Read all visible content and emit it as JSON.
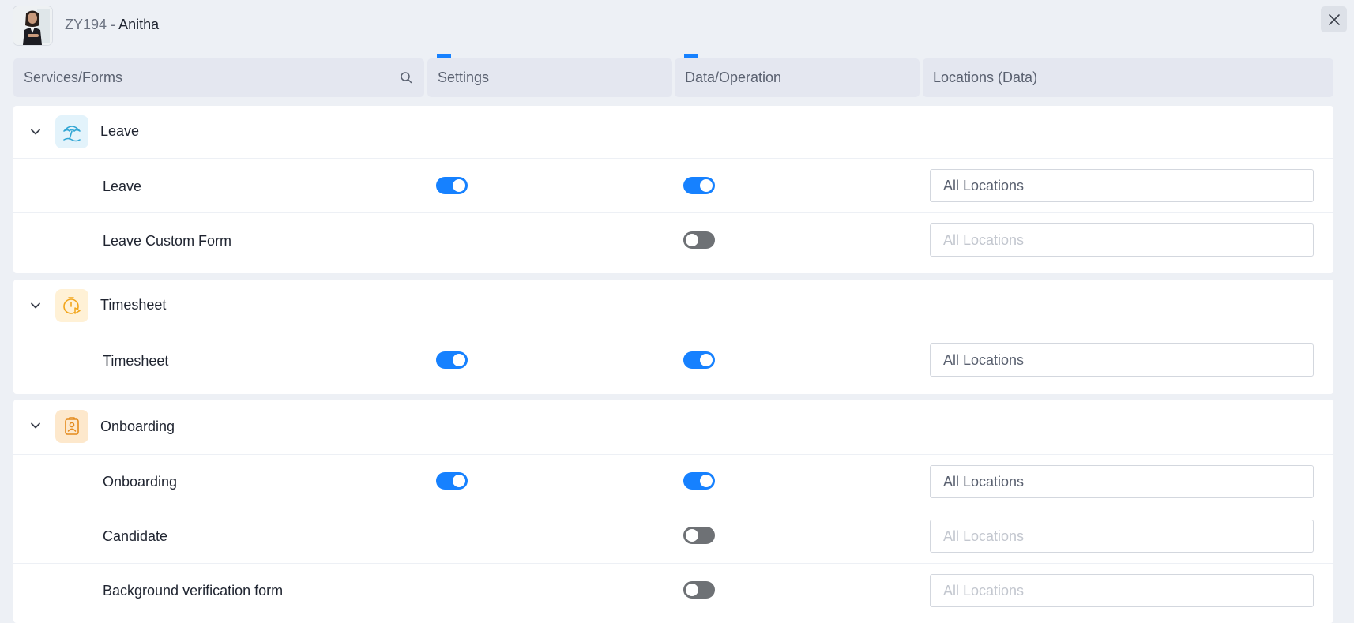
{
  "profile": {
    "id": "ZY194",
    "separator": " - ",
    "name": "Anitha"
  },
  "header": {
    "services": "Services/Forms",
    "settings": "Settings",
    "data_operation": "Data/Operation",
    "locations": "Locations (Data)"
  },
  "modules": [
    {
      "title": "Leave",
      "icon": "beach-umbrella-icon",
      "items": [
        {
          "name": "Leave",
          "settings": true,
          "data": true,
          "locations": "All Locations",
          "locations_enabled": true
        },
        {
          "name": "Leave Custom Form",
          "settings": null,
          "data": false,
          "locations": "All Locations",
          "locations_enabled": false
        }
      ]
    },
    {
      "title": "Timesheet",
      "icon": "stopwatch-icon",
      "items": [
        {
          "name": "Timesheet",
          "settings": true,
          "data": true,
          "locations": "All Locations",
          "locations_enabled": true
        }
      ]
    },
    {
      "title": "Onboarding",
      "icon": "id-badge-icon",
      "items": [
        {
          "name": "Onboarding",
          "settings": true,
          "data": true,
          "locations": "All Locations",
          "locations_enabled": true
        },
        {
          "name": "Candidate",
          "settings": null,
          "data": false,
          "locations": "All Locations",
          "locations_enabled": false
        },
        {
          "name": "Background verification form",
          "settings": null,
          "data": false,
          "locations": "All Locations",
          "locations_enabled": false
        }
      ]
    }
  ],
  "colors": {
    "accent": "#1681ff",
    "toggle_off": "#6e7175",
    "page_bg": "#edf0f5",
    "leave_icon_bg": "#e3f3fb",
    "timesheet_icon_bg": "#fff1d6",
    "onboarding_icon_bg": "#fde8cc"
  }
}
